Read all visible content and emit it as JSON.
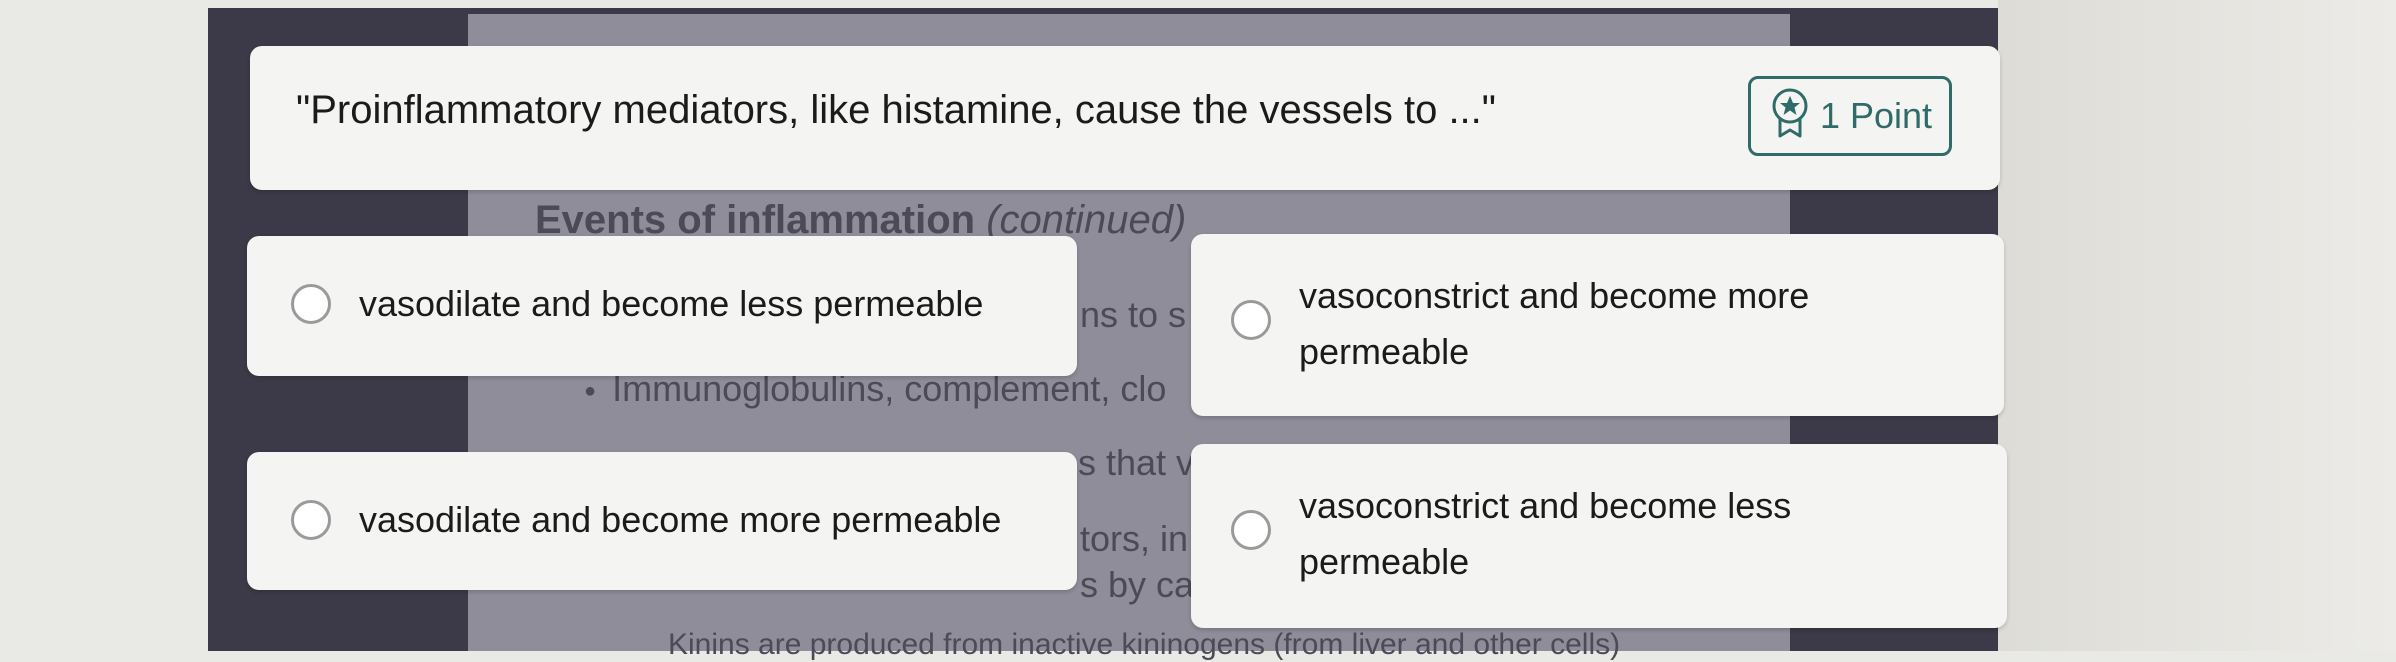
{
  "question": {
    "text": "\"Proinflammatory mediators, like histamine, cause the vessels to ...\"",
    "points_label": "1 Point",
    "points_icon": "award-star-icon"
  },
  "options": [
    {
      "label": "vasodilate and become less permeable",
      "selected": false
    },
    {
      "label": "vasoconstrict and become more permeable",
      "selected": false
    },
    {
      "label": "vasodilate and become more permeable",
      "selected": false
    },
    {
      "label": "vasoconstrict and become less permeable",
      "selected": false
    }
  ],
  "background_slide": {
    "heading": "Events of inflammation",
    "heading_suffix": "(continued)",
    "fragments": [
      "ns to s",
      "s that v",
      "tors, in",
      "s by ca"
    ],
    "bullet": "Immunoglobulins, complement, clo",
    "bottom_line": "Kinins are produced from inactive kininogens (from liver and other cells)"
  },
  "colors": {
    "accent": "#2f6b68",
    "card": "#f4f4f2",
    "slide": "#8f8d9a",
    "frame": "#3c3a48"
  }
}
